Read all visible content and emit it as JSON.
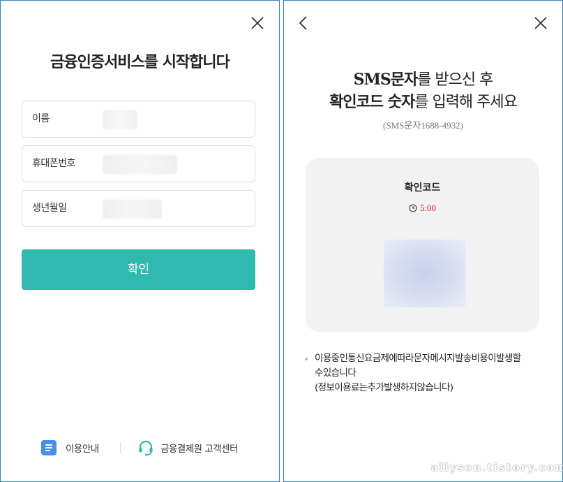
{
  "left_panel": {
    "title": "금융인증서비스를 시작합니다",
    "close_icon": "close-icon",
    "fields": [
      {
        "label": "이름"
      },
      {
        "label": "휴대폰번호"
      },
      {
        "label": "생년월일"
      }
    ],
    "confirm_label": "확인",
    "footer": {
      "guide_label": "이용안내",
      "guide_icon": "document-icon",
      "support_label": "금융결제원 고객센터",
      "support_icon": "headset-icon"
    }
  },
  "right_panel": {
    "back_icon": "chevron-left-icon",
    "close_icon": "close-icon",
    "title_line1_strong": "SMS문자",
    "title_line1_rest": "를 받으신 후",
    "title_line2_strong": "확인코드 숫자",
    "title_line2_rest": "를 입력해 주세요",
    "sms_number": "(SMS문자1688-4932)",
    "code_card": {
      "title": "확인코드",
      "timer": "5:00",
      "clock_icon": "clock-icon"
    },
    "notice_line1": "이용중인통신요금제에따라문자메시지발송비용이발생할",
    "notice_line2": "수있습니다",
    "notice_line3": "(정보이용료는추가발생하지않습니다)"
  },
  "watermark": "allyson.tistory.com",
  "colors": {
    "accent": "#2fb9af",
    "timer": "#e02020",
    "frame": "#2f86c8",
    "doc_icon": "#4a90e2",
    "headset_icon": "#2fb9af"
  }
}
